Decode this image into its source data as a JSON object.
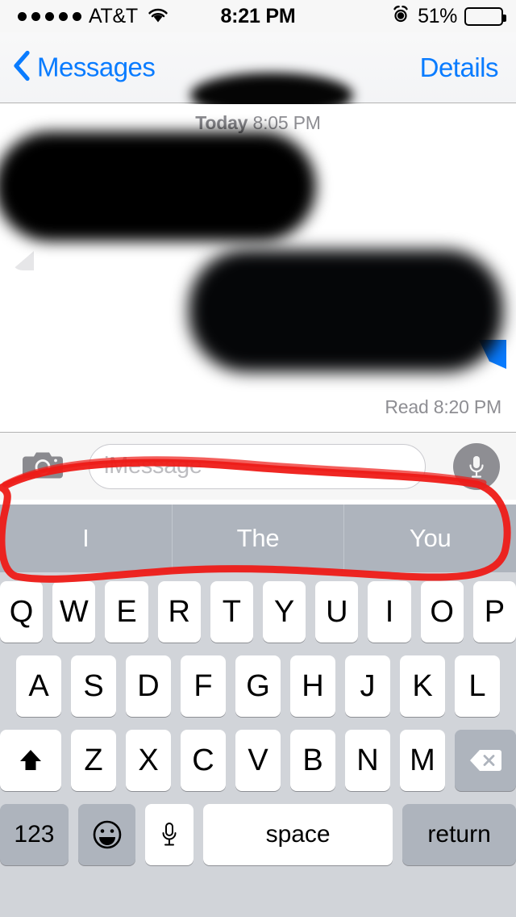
{
  "status_bar": {
    "signal_dots_filled": 5,
    "signal_dots_total": 5,
    "carrier": "AT&T",
    "wifi_icon": "wifi-icon",
    "time": "8:21 PM",
    "alarm_icon": "alarm-clock-icon",
    "battery_percent": "51%",
    "battery_level": 51
  },
  "nav_bar": {
    "back_icon": "chevron-left-icon",
    "back_label": "Messages",
    "contact_name": "",
    "contact_name_redacted": true,
    "details_label": "Details",
    "accent_color": "#0a7cff"
  },
  "conversation": {
    "day_label": "Today",
    "day_time": "8:05 PM",
    "messages": [
      {
        "direction": "incoming",
        "text": "",
        "redacted": true,
        "bubble_color": "#e6e6e8"
      },
      {
        "direction": "outgoing",
        "text": "",
        "redacted": true,
        "bubble_color": "#0a7cff"
      }
    ],
    "delivery_status": "Read 8:20 PM"
  },
  "input_bar": {
    "camera_icon": "camera-icon",
    "placeholder": "iMessage",
    "value": "",
    "mic_icon": "microphone-icon"
  },
  "predictive_bar": {
    "suggestions": [
      "I",
      "The",
      "You"
    ],
    "background_color": "#aeb4bd"
  },
  "keyboard": {
    "background_color": "#d1d4d9",
    "row1": [
      "Q",
      "W",
      "E",
      "R",
      "T",
      "Y",
      "U",
      "I",
      "O",
      "P"
    ],
    "row2": [
      "A",
      "S",
      "D",
      "F",
      "G",
      "H",
      "J",
      "K",
      "L"
    ],
    "row3_letters": [
      "Z",
      "X",
      "C",
      "V",
      "B",
      "N",
      "M"
    ],
    "shift_icon": "shift-arrow-icon",
    "delete_icon": "backspace-delete-icon",
    "numeric_label": "123",
    "emoji_icon": "smiley-face-icon",
    "dictation_icon": "microphone-icon",
    "space_label": "space",
    "return_label": "return"
  },
  "annotation": {
    "type": "freehand-circle",
    "color": "#ee1b17",
    "target": "predictive-bar"
  }
}
